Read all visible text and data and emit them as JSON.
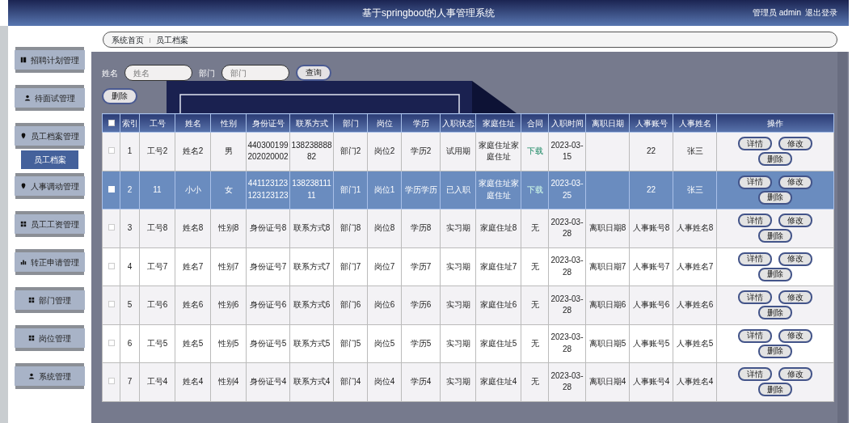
{
  "header": {
    "title": "基于springboot的人事管理系统",
    "user": "管理员 admin",
    "logout": "退出登录"
  },
  "sidebar": {
    "items": [
      {
        "label": "招聘计划管理",
        "selected": false,
        "kind": "menu"
      },
      {
        "label": "待面试管理",
        "selected": false,
        "kind": "menu"
      },
      {
        "label": "员工档案管理",
        "selected": false,
        "kind": "menu"
      },
      {
        "label": "员工档案",
        "selected": true,
        "kind": "sub"
      },
      {
        "label": "人事调动管理",
        "selected": false,
        "kind": "menu"
      },
      {
        "label": "员工工资管理",
        "selected": false,
        "kind": "menu"
      },
      {
        "label": "转正申请管理",
        "selected": false,
        "kind": "menu"
      },
      {
        "label": "部门管理",
        "selected": false,
        "kind": "menu"
      },
      {
        "label": "岗位管理",
        "selected": false,
        "kind": "menu"
      },
      {
        "label": "系统管理",
        "selected": false,
        "kind": "menu"
      }
    ]
  },
  "breadcrumb": [
    "系统首页",
    "员工档案"
  ],
  "search": {
    "fields": [
      {
        "label": "姓名",
        "placeholder": "姓名"
      },
      {
        "label": "部门",
        "placeholder": "部门"
      }
    ],
    "button": "查询"
  },
  "delete_button": "删除",
  "table": {
    "select_all_checked": false,
    "columns": [
      "索引",
      "工号",
      "姓名",
      "性别",
      "身份证号",
      "联系方式",
      "部门",
      "岗位",
      "学历",
      "入职状态",
      "家庭住址",
      "合同",
      "入职时间",
      "离职日期",
      "人事账号",
      "人事姓名",
      "操作"
    ],
    "rows": [
      {
        "selected": false,
        "index": "1",
        "emp_no": "工号2",
        "name": "姓名2",
        "gender": "男",
        "id_no": "440300199202020002",
        "phone": "13823888882",
        "dept": "部门2",
        "post": "岗位2",
        "education": "学历2",
        "status": "试用期",
        "address": "家庭住址家庭住址",
        "contract": {
          "kind": "link",
          "text": "下载"
        },
        "hire_date": "2023-03-15",
        "hr_account": "22",
        "hr_name": "张三",
        "actions": [
          "详情",
          "修改",
          "删除"
        ]
      },
      {
        "selected": true,
        "index": "2",
        "emp_no": "11",
        "name": "小小",
        "gender": "女",
        "id_no": "441123123123123123",
        "phone": "13823811111",
        "dept": "部门1",
        "post": "岗位1",
        "education": "学历学历",
        "status": "已入职",
        "address": "家庭住址家庭住址",
        "contract": {
          "kind": "link",
          "text": "下载"
        },
        "hire_date": "2023-03-25",
        "hr_account": "22",
        "hr_name": "张三",
        "actions": [
          "详情",
          "修改",
          "删除"
        ]
      },
      {
        "selected": false,
        "index": "3",
        "emp_no": "工号8",
        "name": "姓名8",
        "gender": "性别8",
        "id_no": "身份证号8",
        "phone": "联系方式8",
        "dept": "部门8",
        "post": "岗位8",
        "education": "学历8",
        "status": "实习期",
        "address": "家庭住址8",
        "contract": {
          "kind": "text",
          "text": "无"
        },
        "hire_date": "2023-03-28",
        "leave_date": "离职日期8",
        "hr_account": "人事账号8",
        "hr_name": "人事姓名8",
        "actions": [
          "详情",
          "修改",
          "删除"
        ]
      },
      {
        "selected": false,
        "index": "4",
        "emp_no": "工号7",
        "name": "姓名7",
        "gender": "性别7",
        "id_no": "身份证号7",
        "phone": "联系方式7",
        "dept": "部门7",
        "post": "岗位7",
        "education": "学历7",
        "status": "实习期",
        "address": "家庭住址7",
        "contract": {
          "kind": "text",
          "text": "无"
        },
        "hire_date": "2023-03-28",
        "leave_date": "离职日期7",
        "hr_account": "人事账号7",
        "hr_name": "人事姓名7",
        "actions": [
          "详情",
          "修改",
          "删除"
        ]
      },
      {
        "selected": false,
        "index": "5",
        "emp_no": "工号6",
        "name": "姓名6",
        "gender": "性别6",
        "id_no": "身份证号6",
        "phone": "联系方式6",
        "dept": "部门6",
        "post": "岗位6",
        "education": "学历6",
        "status": "实习期",
        "address": "家庭住址6",
        "contract": {
          "kind": "text",
          "text": "无"
        },
        "hire_date": "2023-03-28",
        "leave_date": "离职日期6",
        "hr_account": "人事账号6",
        "hr_name": "人事姓名6",
        "actions": [
          "详情",
          "修改",
          "删除"
        ]
      },
      {
        "selected": false,
        "index": "6",
        "emp_no": "工号5",
        "name": "姓名5",
        "gender": "性别5",
        "id_no": "身份证号5",
        "phone": "联系方式5",
        "dept": "部门5",
        "post": "岗位5",
        "education": "学历5",
        "status": "实习期",
        "address": "家庭住址5",
        "contract": {
          "kind": "text",
          "text": "无"
        },
        "hire_date": "2023-03-28",
        "leave_date": "离职日期5",
        "hr_account": "人事账号5",
        "hr_name": "人事姓名5",
        "actions": [
          "详情",
          "修改",
          "删除"
        ]
      },
      {
        "selected": false,
        "index": "7",
        "emp_no": "工号4",
        "name": "姓名4",
        "gender": "性别4",
        "id_no": "身份证号4",
        "phone": "联系方式4",
        "dept": "部门4",
        "post": "岗位4",
        "education": "学历4",
        "status": "实习期",
        "address": "家庭住址4",
        "contract": {
          "kind": "text",
          "text": "无"
        },
        "hire_date": "2023-03-28",
        "leave_date": "离职日期4",
        "hr_account": "人事账号4",
        "hr_name": "人事姓名4",
        "actions": [
          "详情",
          "修改",
          "删除"
        ]
      }
    ]
  }
}
